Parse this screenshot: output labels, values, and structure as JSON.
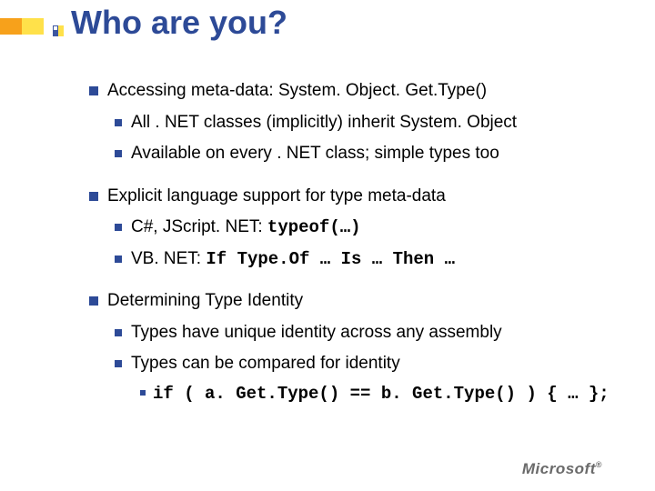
{
  "title": "Who are you?",
  "s1": {
    "heading": "Accessing meta-data: System. Object. Get.Type()",
    "sub1": "All . NET classes (implicitly) inherit System. Object",
    "sub2": "Available on every . NET class; simple types too"
  },
  "s2": {
    "heading": "Explicit language support for type meta-data",
    "sub1_text": "C#, JScript. NET:   ",
    "sub1_code": "typeof(…)",
    "sub2_text": "VB. NET:    ",
    "sub2_code": "If Type.Of … Is … Then …"
  },
  "s3": {
    "heading": "Determining Type Identity",
    "sub1": "Types have unique identity across any assembly",
    "sub2": "Types can be compared for identity",
    "sub2_code": "if ( a. Get.Type() == b. Get.Type() ) { … };"
  },
  "footer": {
    "logo": "Microsoft",
    "reg": "®"
  }
}
